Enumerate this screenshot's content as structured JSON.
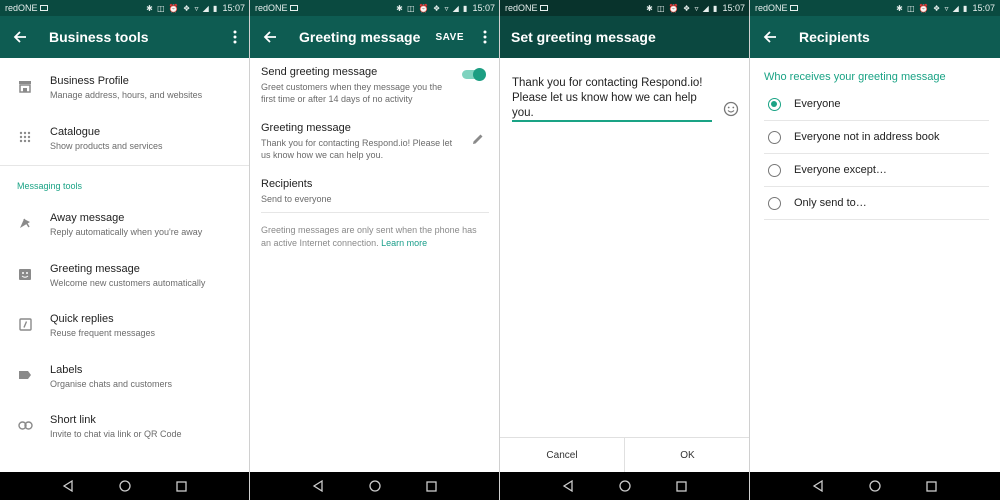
{
  "status_bar": {
    "carrier": "redONE",
    "time": "15:07",
    "icons": "✱ ◫ ⏰ ❖ ▿ ◢ ▮"
  },
  "colors": {
    "app_bar": "#0e5c52",
    "status_bar": "#0a4a40",
    "accent": "#1aa385"
  },
  "business_tools": {
    "title": "Business tools",
    "items": [
      {
        "title": "Business Profile",
        "subtitle": "Manage address, hours, and websites",
        "icon": "store-icon"
      },
      {
        "title": "Catalogue",
        "subtitle": "Show products and services",
        "icon": "grid-icon"
      }
    ],
    "section_label": "Messaging tools",
    "messaging_items": [
      {
        "title": "Away message",
        "subtitle": "Reply automatically when you're away",
        "icon": "away-icon"
      },
      {
        "title": "Greeting message",
        "subtitle": "Welcome new customers automatically",
        "icon": "greeting-icon"
      },
      {
        "title": "Quick replies",
        "subtitle": "Reuse frequent messages",
        "icon": "quick-reply-icon"
      },
      {
        "title": "Labels",
        "subtitle": "Organise chats and customers",
        "icon": "label-icon"
      },
      {
        "title": "Short link",
        "subtitle": "Invite to chat via link or QR Code",
        "icon": "link-icon"
      }
    ]
  },
  "greeting_message": {
    "title": "Greeting message",
    "save_label": "SAVE",
    "send_title": "Send greeting message",
    "send_subtitle": "Greet customers when they message you the first time or after 14 days of no activity",
    "toggle_on": true,
    "message_title": "Greeting message",
    "message_text": "Thank you for contacting Respond.io! Please let us know how we can help you.",
    "recipients_title": "Recipients",
    "recipients_value": "Send to everyone",
    "note": "Greeting messages are only sent when the phone has an active Internet connection.",
    "learn_more": "Learn more"
  },
  "set_greeting": {
    "title": "Set greeting message",
    "text": "Thank you for contacting Respond.io! Please let us know how we can help you.",
    "cancel_label": "Cancel",
    "ok_label": "OK"
  },
  "recipients": {
    "title": "Recipients",
    "label": "Who receives your greeting message",
    "selected": 0,
    "options": [
      "Everyone",
      "Everyone not in address book",
      "Everyone except…",
      "Only send to…"
    ]
  }
}
